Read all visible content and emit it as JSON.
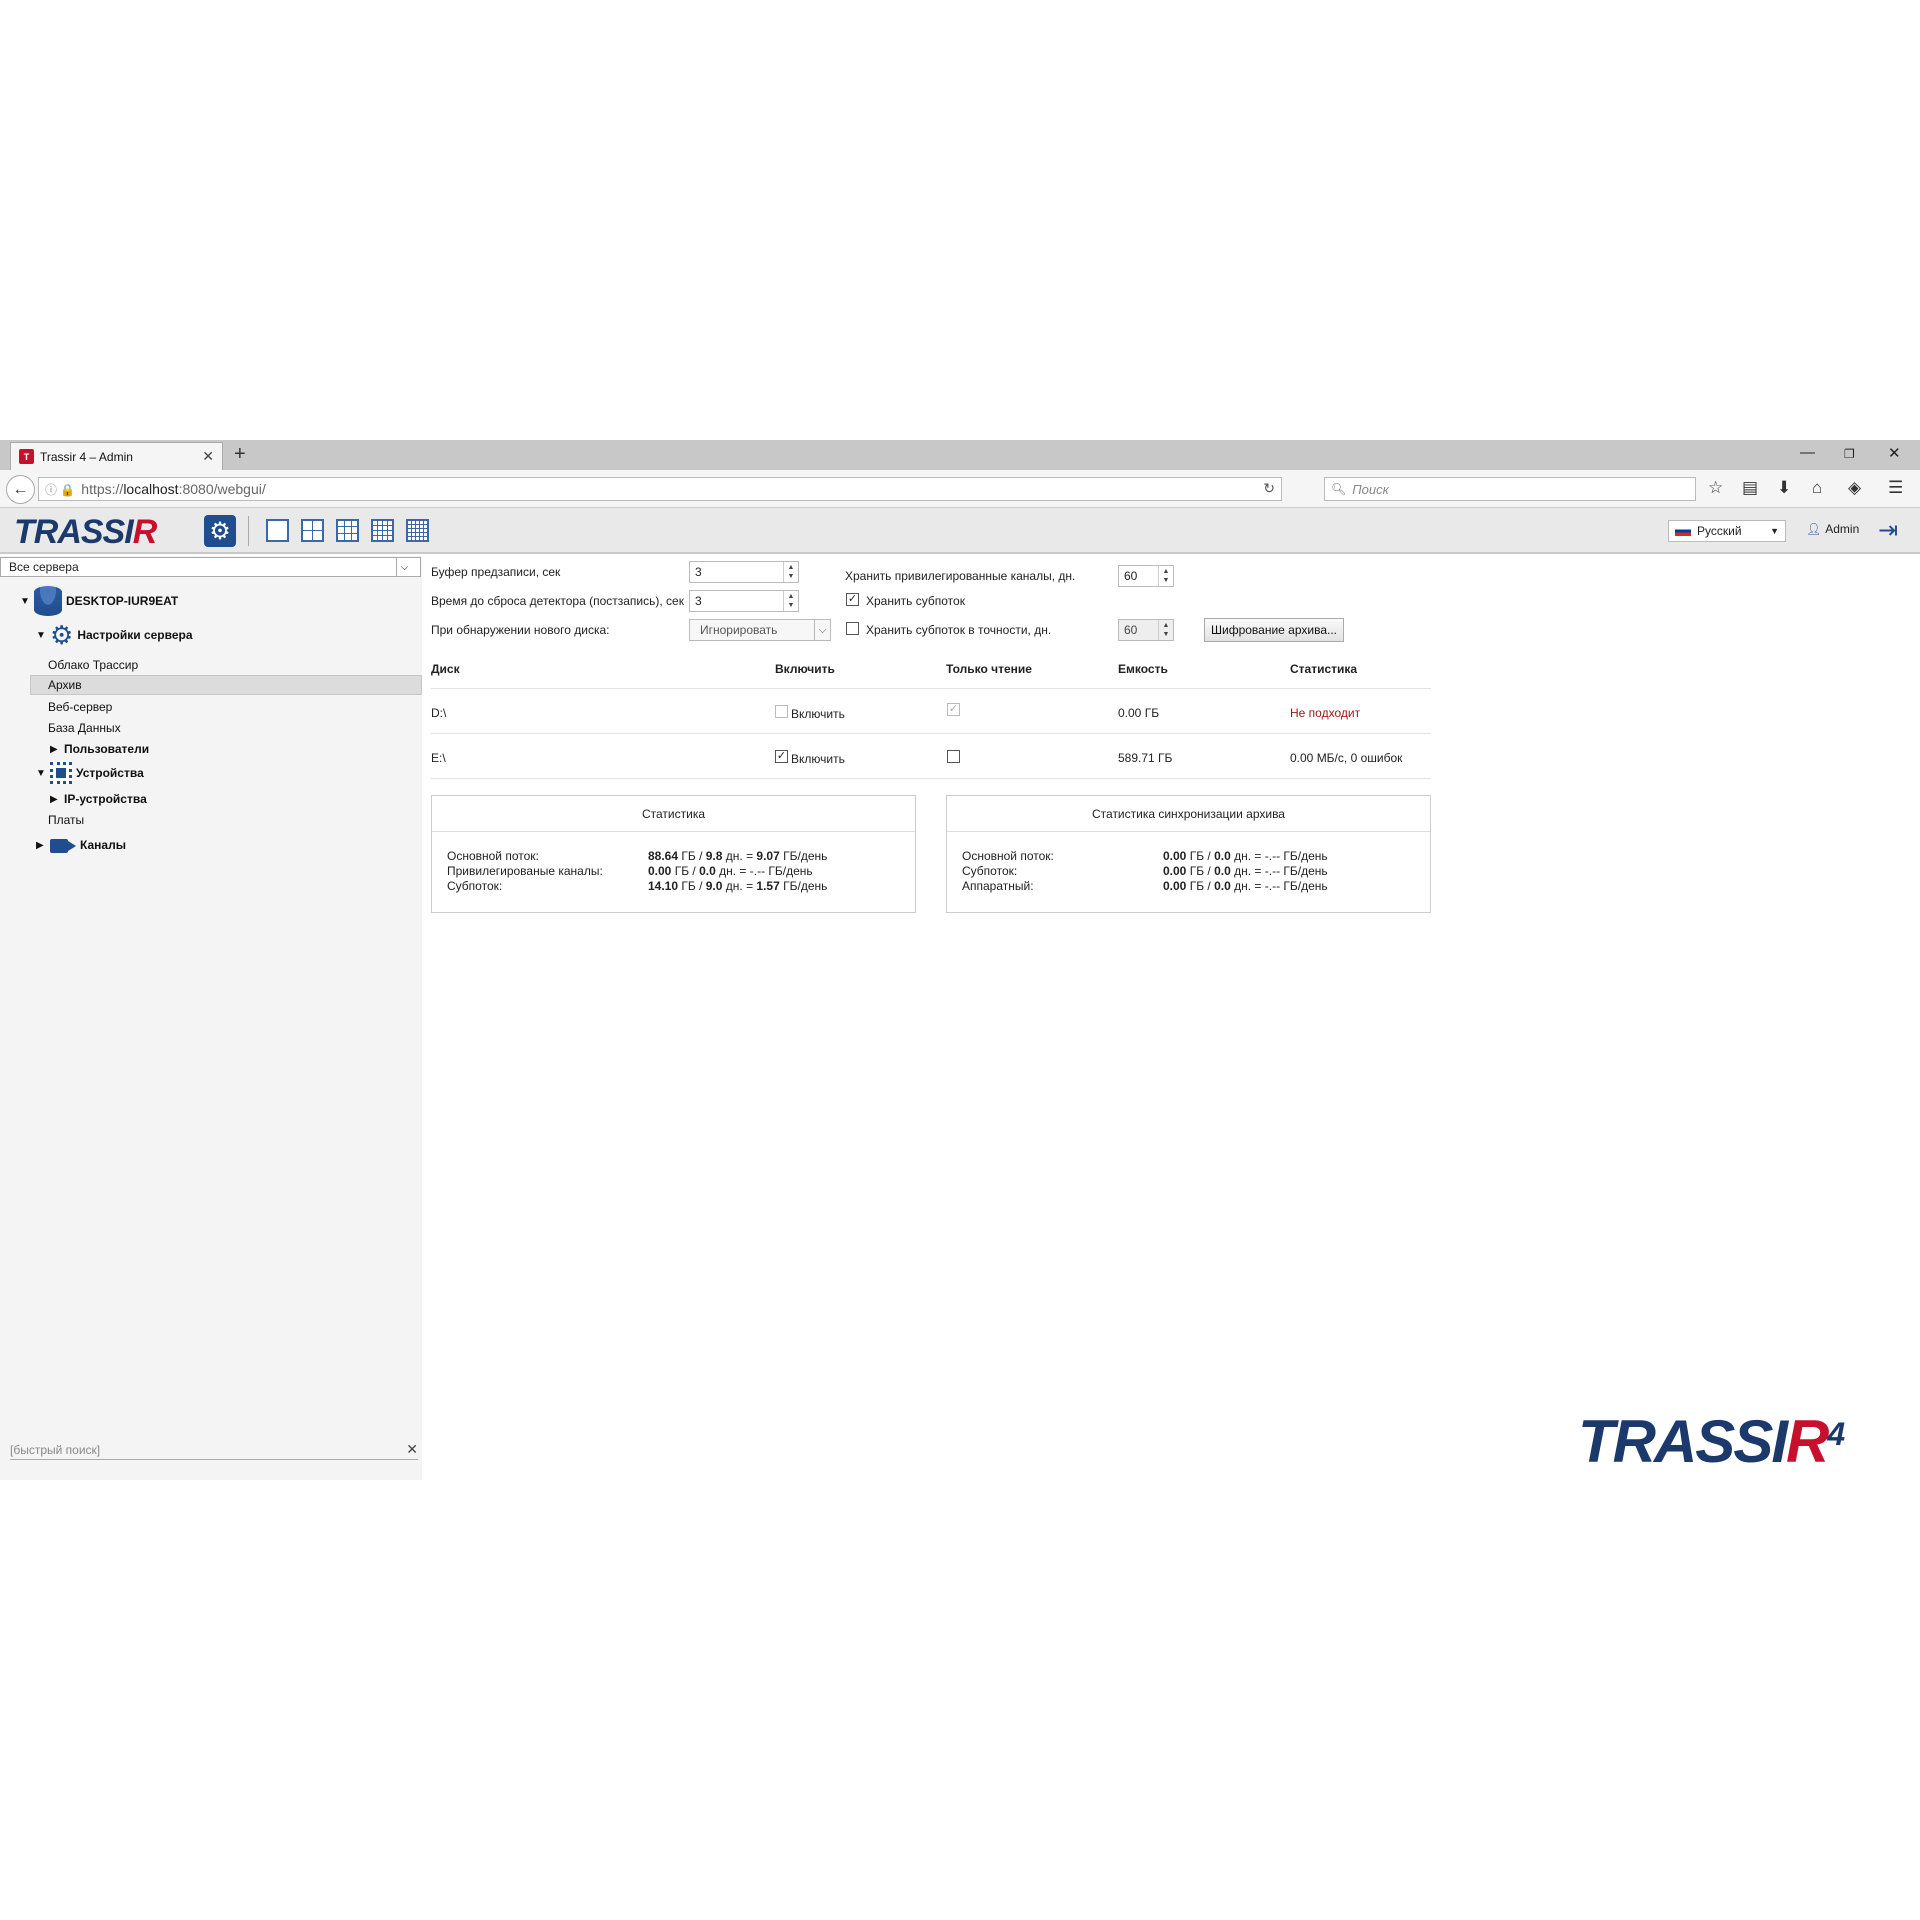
{
  "browser": {
    "tab_title": "Trassir 4 – Admin",
    "tab_icon": "T",
    "url_prefix": "https://",
    "url_host": "localhost",
    "url_rest": ":8080/webgui/",
    "search_placeholder": "Поиск"
  },
  "toolbar": {
    "logo_main": "TRASSI",
    "logo_r": "R",
    "language": "Русский",
    "user": "Admin"
  },
  "sidebar": {
    "server_select": "Все сервера",
    "server_name": "DESKTOP-IUR9EAT",
    "settings": "Настройки сервера",
    "items": [
      "Облако Трассир",
      "Архив",
      "Веб-сервер",
      "База Данных"
    ],
    "users": "Пользователи",
    "devices": "Устройства",
    "ip_devices": "IP-устройства",
    "boards": "Платы",
    "channels": "Каналы",
    "quicksearch_placeholder": "[быстрый поиск]"
  },
  "settings": {
    "prerecord_label": "Буфер предзаписи, сек",
    "prerecord_value": "3",
    "postrecord_label": "Время до сброса детектора (постзапись), сек",
    "postrecord_value": "3",
    "newdisk_label": "При обнаружении нового диска:",
    "newdisk_value": "Игнорировать",
    "priv_label": "Хранить привилегированные каналы, дн.",
    "priv_value": "60",
    "substream_label": "Хранить субпоток",
    "substream_checked": true,
    "substream_days_label": "Хранить субпоток в точности, дн.",
    "substream_days_checked": false,
    "substream_days_value": "60",
    "encrypt_button": "Шифрование архива..."
  },
  "disks": {
    "headers": [
      "Диск",
      "Включить",
      "Только чтение",
      "Емкость",
      "Статистика"
    ],
    "rows": [
      {
        "disk": "D:\\",
        "enable_label": "Включить",
        "enabled": false,
        "readonly": true,
        "capacity": "0.00 ГБ",
        "stat": "Не подходит"
      },
      {
        "disk": "E:\\",
        "enable_label": "Включить",
        "enabled": true,
        "readonly": false,
        "capacity": "589.71 ГБ",
        "stat": "0.00 МБ/с, 0 ошибок"
      }
    ]
  },
  "stats": {
    "title": "Статистика",
    "rows": [
      {
        "label": "Основной поток:",
        "a": "88.64",
        "a_unit": " ГБ / ",
        "b": "9.8",
        "b_unit": " дн. = ",
        "c": "9.07",
        "c_unit": " ГБ/день"
      },
      {
        "label": "Привилегированые каналы:",
        "a": "0.00",
        "a_unit": " ГБ / ",
        "b": "0.0",
        "b_unit": " дн. = ",
        "c": "-.--",
        "c_unit": " ГБ/день"
      },
      {
        "label": "Субпоток:",
        "a": "14.10",
        "a_unit": " ГБ / ",
        "b": "9.0",
        "b_unit": " дн. = ",
        "c": "1.57",
        "c_unit": " ГБ/день"
      }
    ]
  },
  "sync_stats": {
    "title": "Статистика синхронизации архива",
    "rows": [
      {
        "label": "Основной поток:",
        "a": "0.00",
        "a_unit": " ГБ / ",
        "b": "0.0",
        "b_unit": " дн. = ",
        "c": "-.--",
        "c_unit": " ГБ/день"
      },
      {
        "label": "Субпоток:",
        "a": "0.00",
        "a_unit": " ГБ / ",
        "b": "0.0",
        "b_unit": " дн. = ",
        "c": "-.--",
        "c_unit": " ГБ/день"
      },
      {
        "label": "Аппаратный:",
        "a": "0.00",
        "a_unit": " ГБ / ",
        "b": "0.0",
        "b_unit": " дн. = ",
        "c": "-.--",
        "c_unit": " ГБ/день"
      }
    ]
  },
  "watermark": {
    "main": "TRASSI",
    "r": "R",
    "version": "4"
  }
}
